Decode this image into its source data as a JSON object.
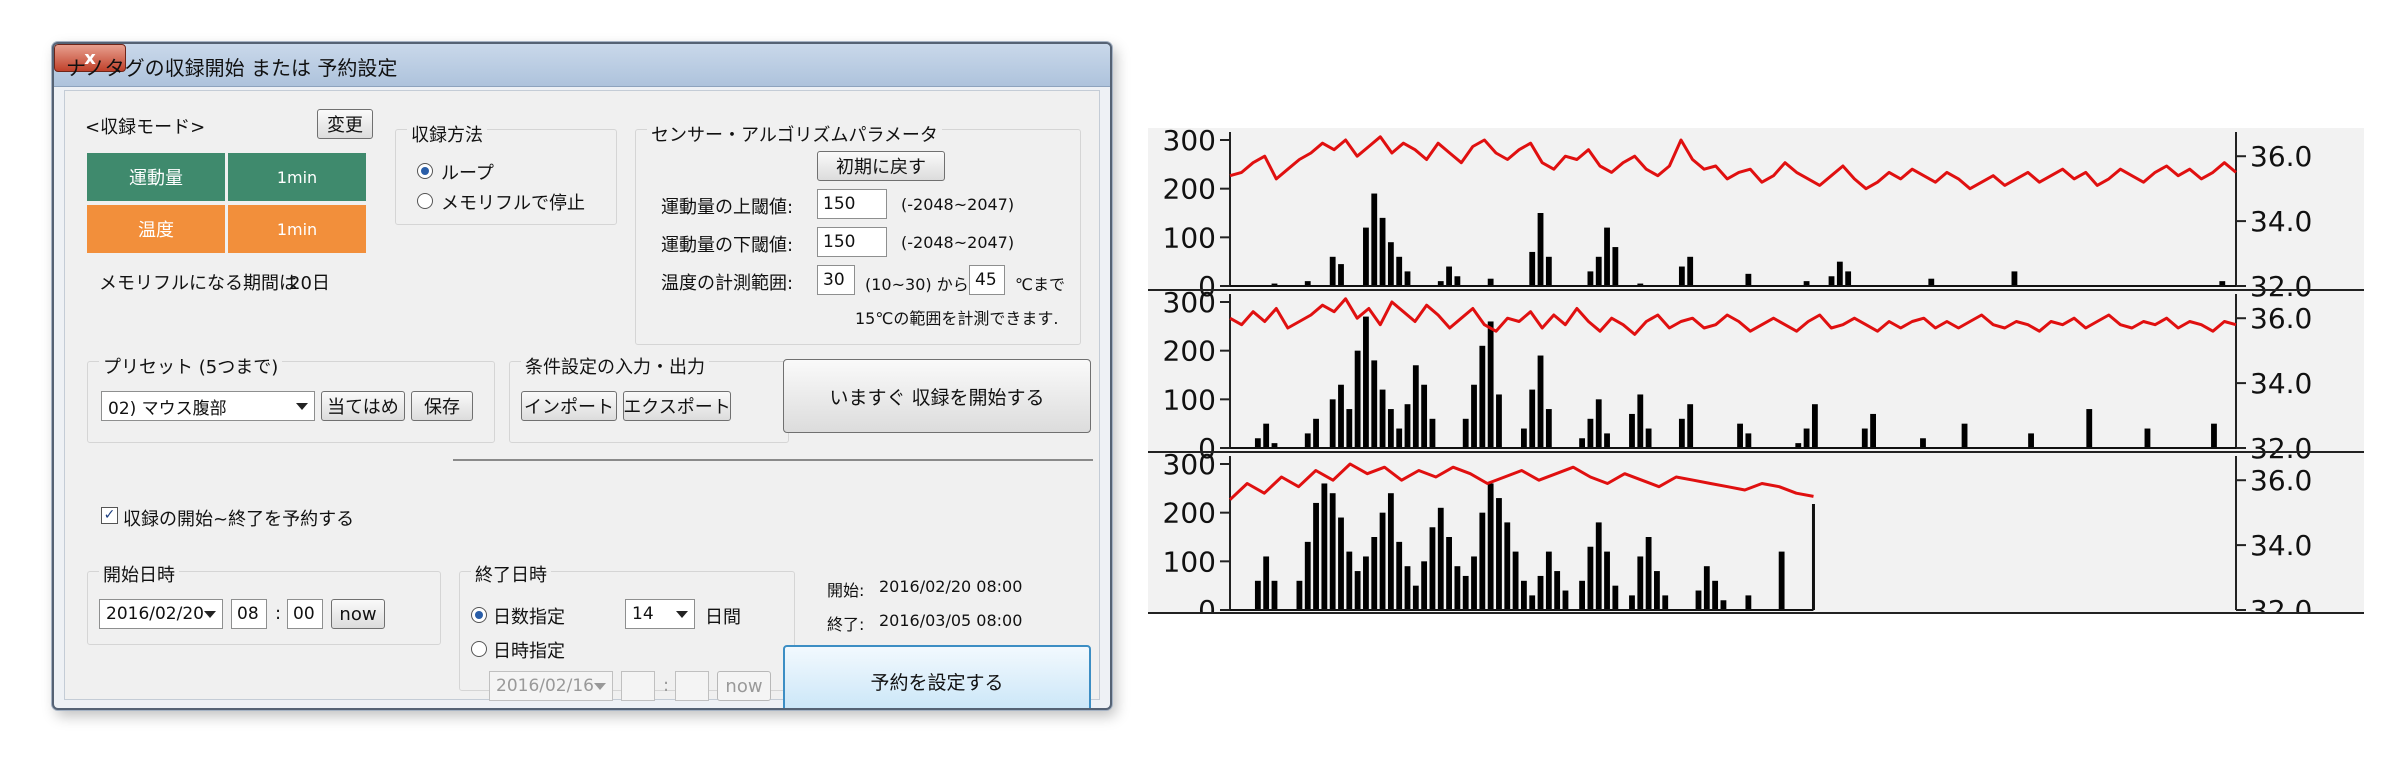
{
  "window": {
    "title": "ナノタグの収録開始 または 予約設定",
    "close_label": "x"
  },
  "record_mode": {
    "header": "<収録モード>",
    "change_label": "変更",
    "rows": [
      {
        "name": "運動量",
        "interval": "1min",
        "color": "#3f8a6d"
      },
      {
        "name": "温度",
        "interval": "1min",
        "color": "#f28f3b"
      }
    ],
    "memory_full_label": "メモリフルになる期間は",
    "memory_full_value": "20日"
  },
  "record_method": {
    "header": "収録方法",
    "options": [
      {
        "label": "ループ",
        "selected": true
      },
      {
        "label": "メモリフルで停止",
        "selected": false
      }
    ]
  },
  "sensor_params": {
    "header": "センサー・アルゴリズムパラメータ",
    "reset_label": "初期に戻す",
    "upper_label": "運動量の上閾値:",
    "upper_value": "150",
    "upper_range": "(-2048~2047)",
    "lower_label": "運動量の下閾値:",
    "lower_value": "150",
    "lower_range": "(-2048~2047)",
    "temp_label": "温度の計測範囲:",
    "temp_from": "30",
    "temp_from_range": "(10~30) から",
    "temp_to": "45",
    "temp_to_suffix": "℃まで",
    "temp_note": "15℃の範囲を計測できます."
  },
  "preset": {
    "header": "プリセット (5つまで)",
    "selected": "02) マウス腹部",
    "apply_label": "当てはめ",
    "save_label": "保存"
  },
  "io": {
    "header": "条件設定の入力・出力",
    "import_label": "インポート",
    "export_label": "エクスポート"
  },
  "start_now_label": "いますぐ 収録を開始する",
  "schedule": {
    "checkbox_label": "収録の開始~終了を予約する",
    "checked": true,
    "start_header": "開始日時",
    "start_date": "2016/02/20",
    "start_hour": "08",
    "start_min": "00",
    "colon": ":",
    "now_label": "now",
    "end_header": "終了日時",
    "days_label": "日数指定",
    "days_value": "14",
    "days_unit": "日間",
    "datetime_label": "日時指定",
    "end_date": "2016/02/16",
    "summary_start_label": "開始:",
    "summary_start_value": "2016/02/20 08:00",
    "summary_end_label": "終了:",
    "summary_end_value": "2016/03/05 08:00",
    "set_label": "予約を設定する"
  },
  "chart_data": {
    "type": "bar",
    "panels": 3,
    "left_ticks": [
      "300",
      "200",
      "100",
      "0"
    ],
    "left_range": [
      0,
      300
    ],
    "right_ticks": [
      "36.0",
      "34.0",
      "32.0"
    ],
    "right_range": [
      32.0,
      36.5
    ],
    "series": [
      {
        "kind": "bar",
        "color": "#000000"
      },
      {
        "kind": "line",
        "color": "#e01010"
      }
    ],
    "panel_extent": [
      1.0,
      1.0,
      0.58
    ],
    "bar_values": [
      [
        0,
        0,
        0,
        0,
        0,
        5,
        0,
        0,
        0,
        10,
        0,
        0,
        60,
        45,
        0,
        0,
        120,
        190,
        140,
        90,
        60,
        30,
        0,
        0,
        0,
        10,
        40,
        20,
        0,
        0,
        0,
        15,
        0,
        0,
        0,
        0,
        70,
        150,
        60,
        0,
        0,
        0,
        0,
        30,
        60,
        120,
        80,
        0,
        0,
        5,
        0,
        0,
        0,
        0,
        40,
        60,
        0,
        0,
        0,
        0,
        0,
        0,
        25,
        0,
        0,
        0,
        0,
        0,
        0,
        10,
        0,
        0,
        20,
        50,
        30,
        0,
        0,
        0,
        0,
        0,
        0,
        0,
        0,
        0,
        15,
        0,
        0,
        0,
        0,
        0,
        0,
        0,
        0,
        0,
        30,
        0,
        0,
        0,
        0,
        0,
        0,
        0,
        0,
        0,
        0,
        0,
        0,
        0,
        0,
        0,
        0,
        0,
        0,
        0,
        0,
        0,
        0,
        0,
        0,
        10,
        0
      ],
      [
        0,
        0,
        0,
        20,
        50,
        10,
        0,
        0,
        0,
        30,
        60,
        0,
        100,
        130,
        80,
        200,
        270,
        180,
        120,
        80,
        40,
        90,
        170,
        130,
        60,
        0,
        0,
        0,
        60,
        130,
        210,
        260,
        110,
        0,
        0,
        40,
        120,
        190,
        80,
        0,
        0,
        0,
        20,
        60,
        100,
        30,
        0,
        0,
        70,
        110,
        40,
        0,
        0,
        0,
        60,
        90,
        0,
        0,
        0,
        0,
        0,
        50,
        30,
        0,
        0,
        0,
        0,
        0,
        10,
        40,
        90,
        0,
        0,
        0,
        0,
        0,
        40,
        70,
        0,
        0,
        0,
        0,
        0,
        20,
        0,
        0,
        0,
        0,
        50,
        0,
        0,
        0,
        0,
        0,
        0,
        0,
        30,
        0,
        0,
        0,
        0,
        0,
        0,
        80,
        0,
        0,
        0,
        0,
        0,
        0,
        40,
        0,
        0,
        0,
        0,
        0,
        0,
        0,
        50,
        0,
        0
      ],
      [
        0,
        0,
        0,
        60,
        110,
        60,
        0,
        0,
        60,
        140,
        220,
        260,
        240,
        190,
        120,
        80,
        110,
        150,
        200,
        240,
        140,
        90,
        50,
        100,
        170,
        210,
        150,
        90,
        70,
        110,
        200,
        260,
        230,
        180,
        120,
        60,
        30,
        70,
        120,
        80,
        40,
        0,
        60,
        130,
        180,
        120,
        50,
        0,
        30,
        110,
        150,
        80,
        30,
        0,
        0,
        0,
        40,
        90,
        60,
        20,
        0,
        0,
        30,
        0,
        0,
        0,
        120,
        0,
        0,
        0,
        0,
        0,
        0,
        0,
        0,
        0,
        0,
        0,
        0,
        0,
        0,
        0,
        0,
        0,
        0,
        0,
        0,
        0,
        0,
        0,
        0,
        0,
        0,
        0,
        0,
        0,
        0,
        0,
        0,
        0,
        0,
        0,
        0,
        0,
        0,
        0,
        0,
        0,
        0,
        0,
        0,
        0,
        0,
        0,
        0,
        0,
        0,
        0,
        0,
        0,
        0
      ]
    ],
    "temp_values": [
      [
        35.4,
        35.5,
        35.8,
        36.0,
        35.3,
        35.6,
        35.9,
        36.1,
        36.4,
        36.2,
        36.5,
        36.0,
        36.3,
        36.6,
        36.1,
        36.4,
        36.2,
        35.9,
        36.4,
        36.1,
        35.8,
        36.3,
        36.5,
        36.1,
        35.9,
        36.2,
        36.4,
        35.8,
        35.6,
        36.0,
        35.9,
        36.2,
        35.7,
        35.5,
        35.8,
        36.0,
        35.6,
        35.4,
        35.7,
        36.5,
        35.9,
        35.6,
        35.7,
        35.3,
        35.5,
        35.6,
        35.2,
        35.4,
        35.8,
        35.5,
        35.3,
        35.1,
        35.4,
        35.7,
        35.3,
        35.0,
        35.2,
        35.5,
        35.3,
        35.6,
        35.4,
        35.2,
        35.5,
        35.3,
        35.0,
        35.2,
        35.4,
        35.1,
        35.3,
        35.5,
        35.2,
        35.4,
        35.6,
        35.3,
        35.5,
        35.1,
        35.3,
        35.6,
        35.4,
        35.2,
        35.5,
        35.7,
        35.4,
        35.6,
        35.3,
        35.5,
        35.8,
        35.5
      ],
      [
        36.0,
        35.8,
        36.2,
        35.9,
        36.3,
        35.7,
        35.9,
        36.1,
        36.4,
        36.2,
        36.6,
        36.0,
        36.3,
        35.8,
        36.5,
        36.2,
        35.9,
        36.4,
        36.1,
        35.7,
        36.0,
        36.3,
        35.8,
        35.6,
        36.0,
        35.9,
        36.2,
        35.7,
        36.1,
        35.8,
        36.3,
        35.9,
        35.6,
        36.0,
        35.8,
        35.5,
        35.9,
        36.1,
        35.7,
        35.9,
        36.0,
        35.7,
        35.8,
        36.1,
        35.9,
        35.6,
        35.8,
        36.0,
        35.8,
        35.6,
        35.9,
        36.1,
        35.7,
        35.8,
        36.0,
        35.8,
        35.6,
        35.9,
        35.7,
        35.9,
        36.0,
        35.7,
        35.9,
        35.7,
        35.9,
        36.1,
        35.8,
        35.7,
        35.9,
        35.8,
        35.6,
        35.9,
        35.8,
        36.0,
        35.7,
        35.9,
        36.1,
        35.8,
        35.7,
        35.9,
        35.8,
        36.0,
        35.7,
        35.9,
        35.8,
        35.6,
        35.9,
        35.8
      ],
      [
        35.4,
        35.9,
        35.6,
        36.1,
        35.8,
        36.3,
        36.0,
        36.5,
        36.2,
        36.4,
        36.0,
        36.3,
        36.1,
        36.4,
        36.2,
        35.9,
        36.1,
        36.3,
        36.0,
        36.2,
        36.4,
        36.1,
        35.9,
        36.2,
        36.0,
        35.8,
        36.1,
        36.0,
        35.9,
        35.8,
        35.7,
        35.9,
        35.8,
        35.6,
        35.5
      ]
    ]
  }
}
